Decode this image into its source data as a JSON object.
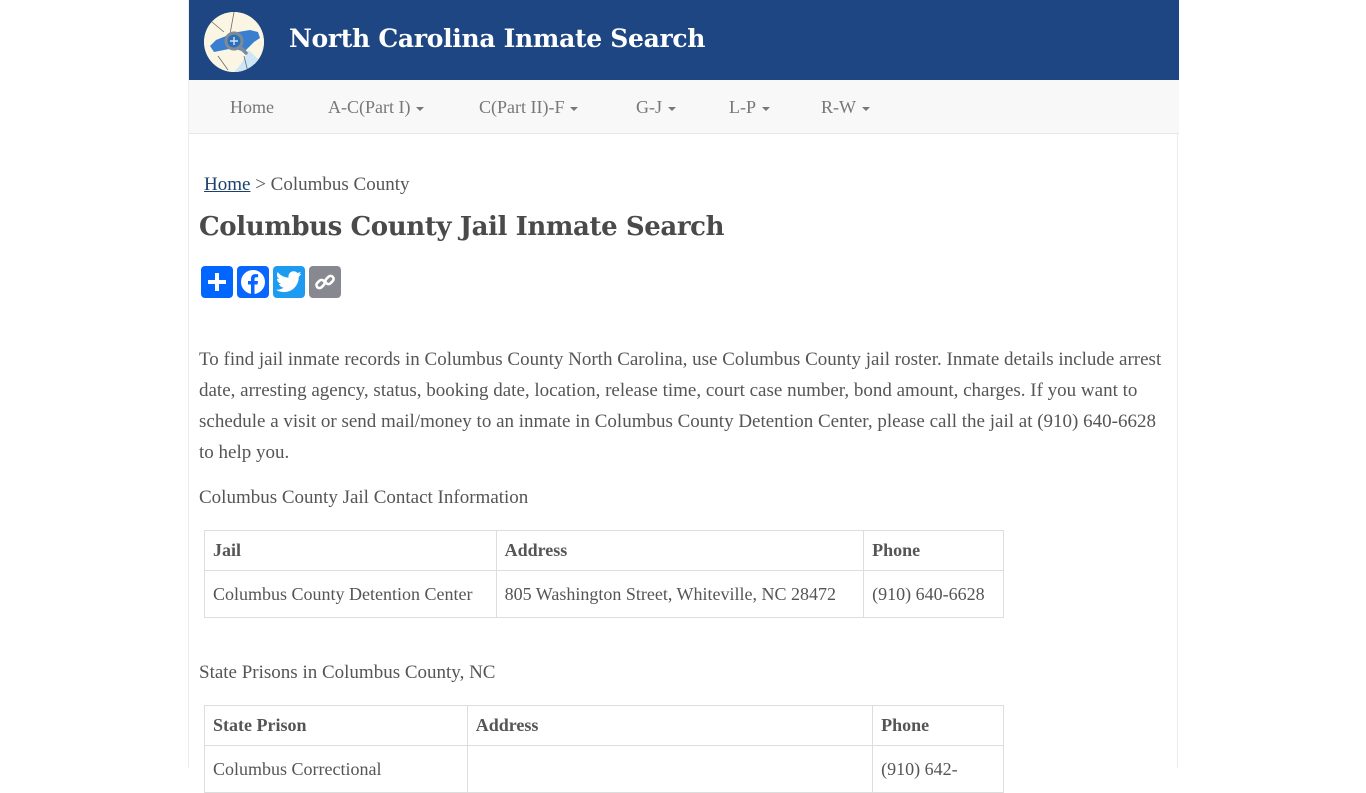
{
  "header": {
    "site_title": "North Carolina Inmate Search",
    "logo_icon": "nc-map-magnifier-logo",
    "colors": {
      "header_bg": "#1d4682",
      "nav_bg": "#f8f8f8"
    }
  },
  "nav": {
    "items": [
      {
        "label": "Home",
        "dropdown": false
      },
      {
        "label": "A-C(Part I)",
        "dropdown": true
      },
      {
        "label": "C(Part II)-F",
        "dropdown": true
      },
      {
        "label": "G-J",
        "dropdown": true
      },
      {
        "label": "L-P",
        "dropdown": true
      },
      {
        "label": "R-W",
        "dropdown": true
      }
    ]
  },
  "breadcrumb": {
    "home_label": "Home",
    "separator": ">",
    "current": "Columbus County"
  },
  "page_title": "Columbus County Jail Inmate Search",
  "share": {
    "buttons": [
      {
        "name": "share",
        "icon": "plus-icon",
        "color": "#0166ff"
      },
      {
        "name": "facebook",
        "icon": "facebook-icon",
        "color": "#0866ff"
      },
      {
        "name": "twitter",
        "icon": "twitter-icon",
        "color": "#1d9bf0"
      },
      {
        "name": "copy-link",
        "icon": "link-icon",
        "color": "#888990"
      }
    ]
  },
  "intro_text": "To find jail inmate records in Columbus County North Carolina, use Columbus County jail roster. Inmate details include arrest date, arresting agency, status, booking date, location, release time, court case number, bond amount, charges. If you want to schedule a visit or send mail/money to an inmate in Columbus County Detention Center, please call the jail at (910) 640-6628 to help you.",
  "jail_section": {
    "label": "Columbus County Jail Contact Information",
    "headers": [
      "Jail",
      "Address",
      "Phone"
    ],
    "rows": [
      [
        "Columbus County Detention Center",
        "805 Washington Street, Whiteville, NC 28472",
        "(910) 640-6628"
      ]
    ]
  },
  "prison_section": {
    "label": "State Prisons in Columbus County, NC",
    "headers": [
      "State Prison",
      "Address",
      "Phone"
    ],
    "rows": [
      [
        "Columbus Correctional",
        "",
        "(910) 642-"
      ]
    ]
  }
}
